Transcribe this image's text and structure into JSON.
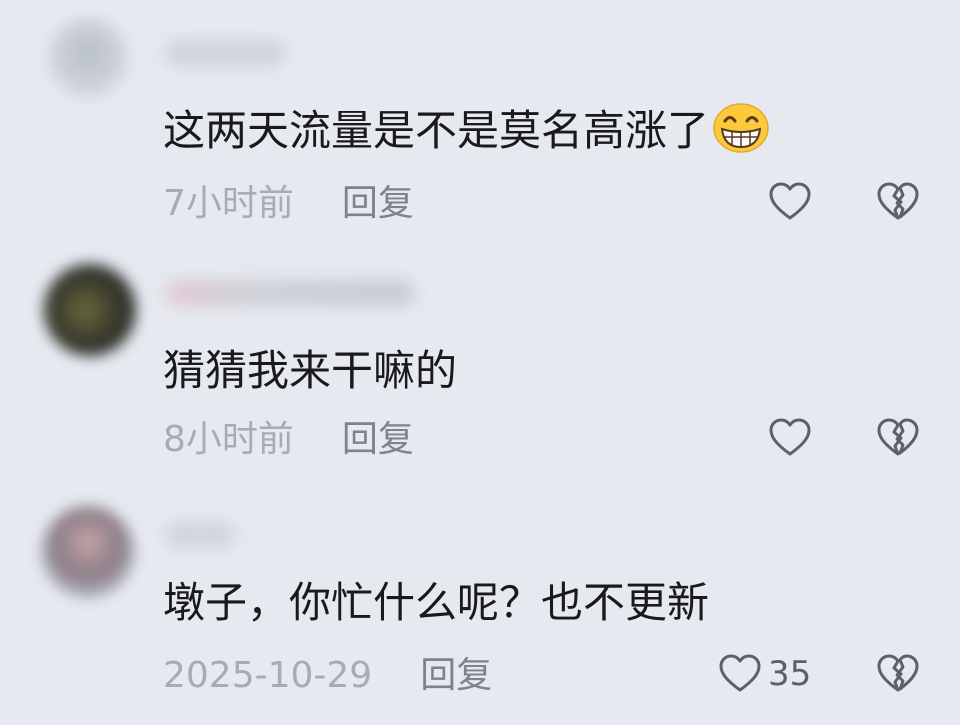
{
  "comments": [
    {
      "text": "这两天流量是不是莫名高涨了",
      "emoji": "grinning-face-emoji",
      "time": "7小时前",
      "reply_label": "回复",
      "like_count": ""
    },
    {
      "text": "猜猜我来干嘛的",
      "time": "8小时前",
      "reply_label": "回复",
      "like_count": ""
    },
    {
      "text": "墩子，你忙什么呢？也不更新",
      "time": "2025-10-29",
      "reply_label": "回复",
      "like_count": "35"
    }
  ],
  "icons": {
    "like": "heart-outline-icon",
    "dislike": "broken-heart-icon"
  },
  "colors": {
    "background": "#e6eaf0",
    "text": "#1a1a1a",
    "meta": "#a7acb3",
    "reply": "#7d838c",
    "icon": "#5c6068"
  }
}
